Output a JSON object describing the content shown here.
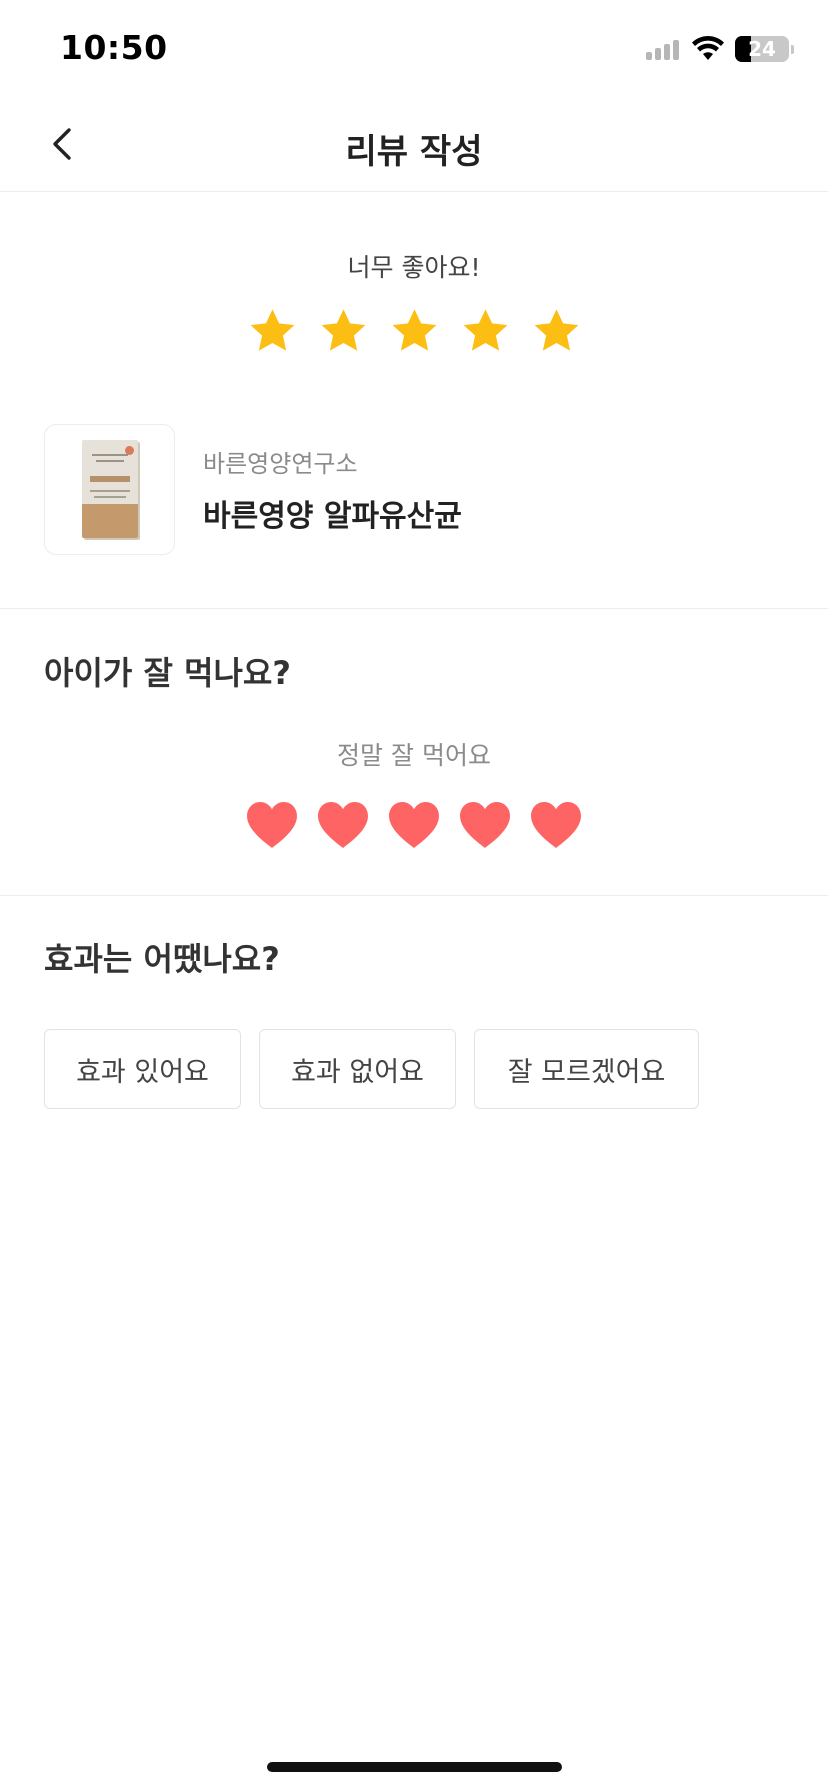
{
  "status_bar": {
    "time": "10:50",
    "battery": "24",
    "icons": [
      "cellular-signal-icon",
      "wifi-icon",
      "battery-icon"
    ]
  },
  "nav": {
    "back_icon": "chevron-left-icon",
    "title": "리뷰 작성"
  },
  "rating": {
    "label": "너무 좋아요!",
    "value": 5,
    "max": 5,
    "star_color": "#FCBE12"
  },
  "product": {
    "brand": "바른영양연구소",
    "name": "바른영양 알파유산균"
  },
  "eating": {
    "title": "아이가 잘 먹나요?",
    "label": "정말 잘 먹어요",
    "value": 5,
    "max": 5,
    "heart_color": "#FF6464"
  },
  "effect": {
    "title": "효과는 어땠나요?",
    "options": [
      "효과 있어요",
      "효과 없어요",
      "잘 모르겠어요"
    ]
  },
  "colors": {
    "background": "#FFFFFF",
    "divider": "#ECECEC",
    "text_primary": "#222222",
    "text_secondary": "#8B8B8B"
  }
}
